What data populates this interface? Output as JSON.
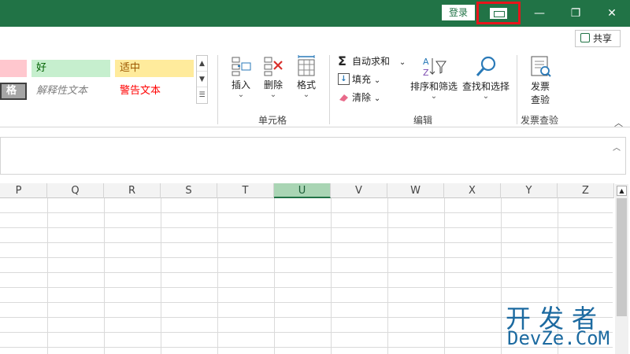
{
  "titlebar": {
    "login_label": "登录",
    "window_controls": [
      "minimize-icon",
      "restore-icon",
      "close-icon"
    ],
    "minimize_glyph": "—",
    "restore_glyph": "❐",
    "close_glyph": "✕",
    "color": "#217346"
  },
  "ribbon": {
    "share_label": "共享",
    "styles": {
      "bad": "",
      "good": "好",
      "neutral": "适中",
      "check": "格",
      "explanatory": "解释性文本",
      "warning": "警告文本"
    },
    "cells_group": {
      "insert_label": "插入",
      "delete_label": "删除",
      "format_label": "格式",
      "group_label": "单元格"
    },
    "editing_group": {
      "autosum_label": "自动求和",
      "fill_label": "填充",
      "clear_label": "清除",
      "sort_filter_label": "排序和筛选",
      "find_select_label": "查找和选择",
      "group_label": "编辑"
    },
    "invoice_group": {
      "invoice_check_label_1": "发票",
      "invoice_check_label_2": "查验",
      "group_label": "发票查验"
    }
  },
  "grid": {
    "columns": [
      "P",
      "Q",
      "R",
      "S",
      "T",
      "U",
      "V",
      "W",
      "X",
      "Y",
      "Z"
    ],
    "selected_column": "U"
  },
  "watermark": {
    "line1": "开发者",
    "line2": "DevZe.CoM"
  }
}
